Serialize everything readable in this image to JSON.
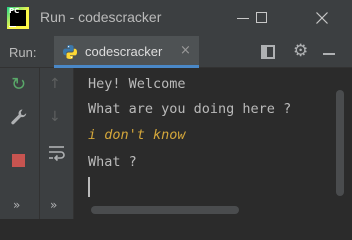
{
  "window": {
    "title": "Run - codescracker",
    "app_logo_text": "PC",
    "close_glyph": "✕"
  },
  "run_bar": {
    "label": "Run:",
    "tab": {
      "label": "codescracker",
      "close_glyph": "×",
      "icon": "python-icon"
    },
    "icons": [
      "layout-icon",
      "gear-icon",
      "minimize-icon"
    ]
  },
  "toolbar_left": {
    "icons": [
      "rerun-icon",
      "wrench-icon",
      "stop-icon",
      "more-icon"
    ],
    "rerun_glyph": "↻",
    "wrench_glyph": "🔧",
    "more_glyph": "»"
  },
  "toolbar_right": {
    "icons": [
      "scroll-up-icon",
      "scroll-down-icon",
      "soft-wrap-icon",
      "more-icon"
    ],
    "up_glyph": "↑",
    "down_glyph": "↓",
    "wrap_glyph": "⇆",
    "more_glyph": "»"
  },
  "console": {
    "lines": [
      {
        "text": "Hey! Welcome",
        "kind": "output"
      },
      {
        "text": "What are you doing here ?",
        "kind": "output"
      },
      {
        "text": "i don't know",
        "kind": "input"
      },
      {
        "text": "What ?",
        "kind": "output"
      }
    ],
    "input_color": "#d4a73b",
    "output_color": "#bababa"
  },
  "colors": {
    "panel_bg": "#3c3f41",
    "console_bg": "#2b2b2b",
    "tab_accent": "#4a88c7",
    "rerun_green": "#59a869",
    "stop_red": "#c75450"
  }
}
